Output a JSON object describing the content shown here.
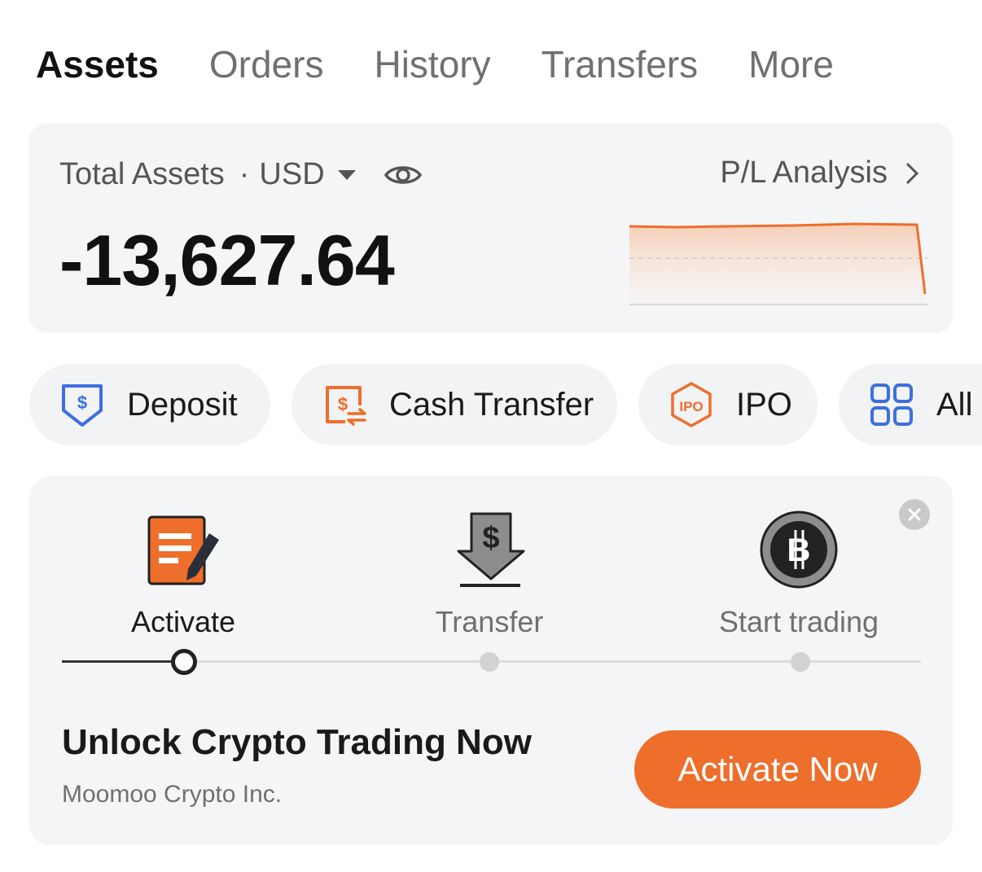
{
  "tabs": [
    {
      "label": "Assets",
      "active": true
    },
    {
      "label": "Orders",
      "active": false
    },
    {
      "label": "History",
      "active": false
    },
    {
      "label": "Transfers",
      "active": false
    },
    {
      "label": "More",
      "active": false
    }
  ],
  "assets": {
    "label": "Total Assets",
    "separator": "·",
    "currency": "USD",
    "balance": "-13,627.64",
    "pl_link": "P/L Analysis",
    "icons": {
      "visibility": "eye-icon",
      "currency_dropdown": "caret-down-icon",
      "pl_arrow": "chevron-right-icon"
    }
  },
  "quick_actions": [
    {
      "label": "Deposit",
      "icon": "deposit-icon"
    },
    {
      "label": "Cash Transfer",
      "icon": "cash-transfer-icon"
    },
    {
      "label": "IPO",
      "icon": "ipo-icon",
      "icon_text": "IPO"
    },
    {
      "label": "All",
      "icon": "grid-icon"
    }
  ],
  "crypto_onboarding": {
    "steps": [
      {
        "label": "Activate",
        "icon": "document-edit-icon",
        "current": true
      },
      {
        "label": "Transfer",
        "icon": "dollar-download-icon",
        "current": false
      },
      {
        "label": "Start trading",
        "icon": "bitcoin-icon",
        "current": false
      }
    ],
    "progress": 0.0,
    "title": "Unlock Crypto Trading Now",
    "subtitle": "Moomoo Crypto Inc.",
    "cta_label": "Activate Now"
  },
  "colors": {
    "accent": "#EE6E2B",
    "card_bg": "#F4F5F7",
    "pill_bg": "#F2F3F5",
    "blue_icon": "#3E6FE0"
  }
}
